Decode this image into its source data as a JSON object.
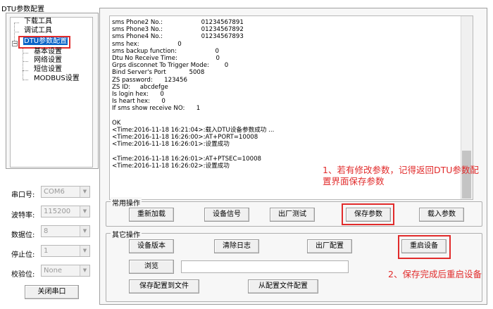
{
  "window": {
    "title": "DTU参数配置"
  },
  "tree": {
    "items": [
      {
        "label": "下载工具"
      },
      {
        "label": "调试工具"
      },
      {
        "label": "DTU参数配置"
      },
      {
        "label": "基本设置"
      },
      {
        "label": "网络设置"
      },
      {
        "label": "短信设置"
      },
      {
        "label": "MODBUS设置"
      }
    ]
  },
  "serial": {
    "port_label": "串口号:",
    "port_value": "COM6",
    "baud_label": "波特率:",
    "baud_value": "115200",
    "data_label": "数据位:",
    "data_value": "8",
    "stop_label": "停止位:",
    "stop_value": "1",
    "parity_label": "校验位:",
    "parity_value": "None",
    "close_button": "关闭串口"
  },
  "log": {
    "lines": [
      "sms Phone2 No.:                    01234567891",
      "sms Phone3 No.:                    01234567892",
      "sms Phone4 No.:                    01234567893",
      "sms hex:                    0",
      "sms backup function:                    0",
      "Dtu No Receive Time:                    0",
      "Grps disconnet To Trigger Mode:        0",
      "Bind Server's Port            5008",
      "ZS password:      123456",
      "ZS ID:     abcdefge",
      "Is login hex:      0",
      "Is heart hex:      0",
      "If sms show receive NO:      1",
      "",
      "OK",
      "<Time:2016-11-18 16:21:04>:载入DTU设备参数成功 ...",
      "<Time:2016-11-18 16:26:00>:AT+PORT=10008",
      "<Time:2016-11-18 16:26:01>:设置成功",
      "",
      "<Time:2016-11-18 16:26:01>:AT+PTSEC=10008",
      "<Time:2016-11-18 16:26:02>:设置成功"
    ]
  },
  "common_ops": {
    "title": "常用操作",
    "reload": "重新加载",
    "signal": "设备信号",
    "factory_test": "出厂测试",
    "save_params": "保存参数",
    "load_params": "载入参数"
  },
  "other_ops": {
    "title": "其它操作",
    "version": "设备版本",
    "clear_log": "清除日志",
    "factory_config": "出厂配置",
    "restart": "重启设备",
    "browse": "浏览",
    "browse_path": "",
    "save_to_file": "保存配置到文件",
    "load_from_file": "从配置文件配置"
  },
  "annotations": {
    "note1_line1": "1、若有修改参数，记得返回DTU参数配",
    "note1_line2": "置界面保存参数",
    "note2": "2、保存完成后重启设备",
    "color": "#e12b2b"
  }
}
